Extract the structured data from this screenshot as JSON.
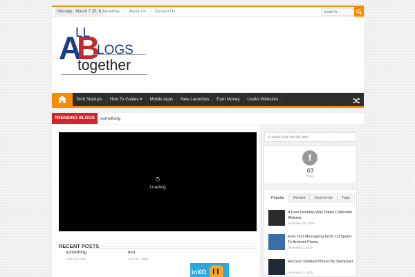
{
  "topbar": {
    "date": "Monday , March 7 2016",
    "links": [
      "Advertise",
      "About Us",
      "Contact Us"
    ],
    "search_placeholder": "Search..."
  },
  "logo": {
    "letters": [
      "A",
      "LL",
      "B",
      "LOGS",
      "together"
    ],
    "colors": {
      "blue": "#1b3a8c",
      "red": "#c62828"
    }
  },
  "nav": {
    "items": [
      "Tech Startups",
      "How To Guides ▾",
      "Mobile Apps",
      "New Launches",
      "Earn Money",
      "Useful Websites"
    ],
    "accent": "#f88c00",
    "background": "#2d2d2d"
  },
  "trending": {
    "label": "TRENDING BLOGS",
    "text": "something"
  },
  "video": {
    "loading_text": "Loading"
  },
  "recent": {
    "title": "RECENT POSTS",
    "posts": [
      {
        "title": "something",
        "date": "June 13, 2015"
      },
      {
        "title": "test",
        "date": "June 11, 2015"
      }
    ],
    "ad_text": "inXO"
  },
  "sidebar": {
    "search_placeholder": "to search type and hit enter",
    "facebook": {
      "icon": "f",
      "count": "63",
      "label": "Fans"
    },
    "tabs": [
      "Popular",
      "Recent",
      "Comments",
      "Tags"
    ],
    "popular": [
      {
        "title": "A Free Desktop Wall Paper Collection Website",
        "date": "November 20, 2015"
      },
      {
        "title": "Free Text Messaging From Computer To Android Phone",
        "date": "December 2, 2015"
      },
      {
        "title": "Recover Deleted Photos By Dumpster",
        "date": "December 2, 2015"
      }
    ]
  }
}
